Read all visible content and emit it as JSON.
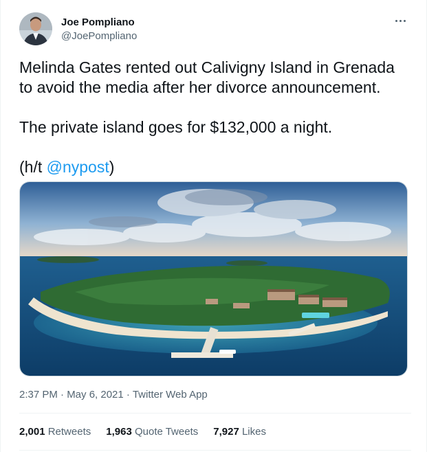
{
  "author": {
    "display_name": "Joe Pompliano",
    "handle": "@JoePompliano"
  },
  "tweet": {
    "line1": "Melinda Gates rented out Calivigny Island in Grenada",
    "line2": "to avoid the media after her divorce announcement.",
    "line3": "The private island goes for $132,000 a night.",
    "ht_prefix": "(h/t ",
    "ht_mention": "@nypost",
    "ht_suffix": ")"
  },
  "meta": {
    "timestamp": "2:37 PM · May 6, 2021",
    "separator": " · ",
    "source": "Twitter Web App"
  },
  "stats": {
    "retweets_count": "2,001",
    "retweets_label": "Retweets",
    "quotes_count": "1,963",
    "quotes_label": "Quote Tweets",
    "likes_count": "7,927",
    "likes_label": "Likes"
  },
  "icons": {
    "more": "more-horizontal-icon"
  },
  "colors": {
    "link": "#1d9bf0",
    "secondary_text": "#536471",
    "primary_text": "#0f1419"
  }
}
